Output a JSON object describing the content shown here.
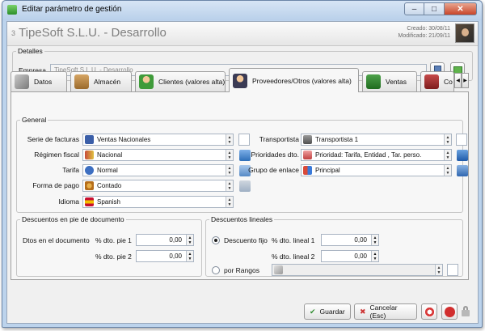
{
  "window": {
    "title": "Editar parámetro de gestión",
    "minimize": "–",
    "maximize": "□",
    "close": "✕"
  },
  "header": {
    "record_number": "3",
    "company": "TipeSoft S.L.U. - Desarrollo",
    "created": "Creado: 30/08/11",
    "modified": "Modificado: 21/09/11"
  },
  "details": {
    "legend": "Detalles",
    "empresa_label": "Empresa",
    "empresa_value": "TipeSoft S.L.U. - Desarrollo"
  },
  "tabs": [
    {
      "label": "Datos",
      "icon": "wrench-icon"
    },
    {
      "label": "Almacén",
      "icon": "box-icon"
    },
    {
      "label": "Clientes (valores alta)",
      "icon": "person-green-icon"
    },
    {
      "label": "Proveedores/Otros (valores alta)",
      "icon": "person-suit-icon",
      "active": true
    },
    {
      "label": "Ventas",
      "icon": "green-book-icon"
    },
    {
      "label": "Co",
      "icon": "red-book-icon"
    }
  ],
  "general": {
    "legend": "General",
    "serie_label": "Serie de facturas",
    "serie_value": "Ventas Nacionales",
    "regimen_label": "Régimen fiscal",
    "regimen_value": "Nacional",
    "tarifa_label": "Tarifa",
    "tarifa_value": "Normal",
    "forma_pago_label": "Forma de pago",
    "forma_pago_value": "Contado",
    "idioma_label": "Idioma",
    "idioma_value": "Spanish",
    "transportista_label": "Transportista",
    "transportista_value": "Transportista 1",
    "prioridades_label": "Prioridades dto.",
    "prioridades_value": "Prioridad: Tarifa, Entidad , Tar. perso.",
    "grupo_label": "Grupo de enlace",
    "grupo_value": "Principal"
  },
  "descuentos_pie": {
    "legend": "Descuentos en pie de documento",
    "dtos_label": "Dtos en el documento",
    "pie1_label": "% dto. pie 1",
    "pie1_value": "0,00",
    "pie2_label": "% dto. pie 2",
    "pie2_value": "0,00"
  },
  "descuentos_lineales": {
    "legend": "Descuentos lineales",
    "fijo_label": "Descuento fijo",
    "lineal1_label": "% dto. lineal 1",
    "lineal1_value": "0,00",
    "lineal2_label": "% dto. lineal 2",
    "lineal2_value": "0,00",
    "rangos_label": "por Rangos"
  },
  "footer": {
    "save_label": "Guardar",
    "cancel_label": "Cancelar (Esc)"
  },
  "colors": {
    "accent": "#bcd3ec",
    "panel": "#f7f7f7",
    "title_text": "#7f7f7f"
  }
}
